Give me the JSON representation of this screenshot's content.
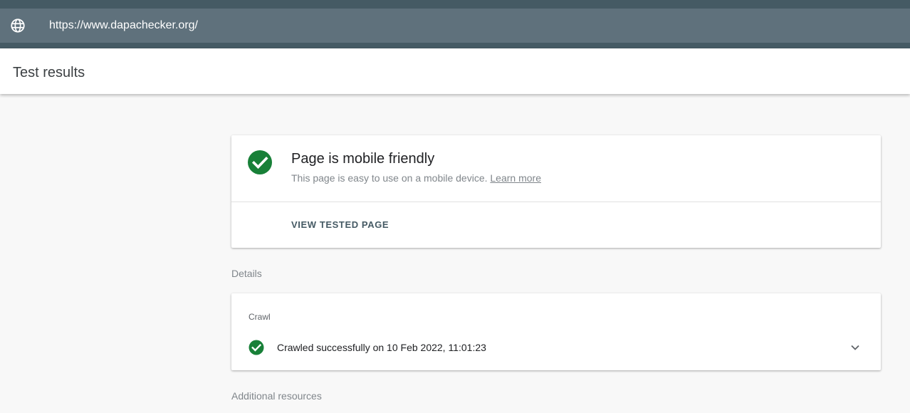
{
  "url_bar": {
    "url": "https://www.dapachecker.org/",
    "icon": "globe-icon"
  },
  "header": {
    "title": "Test results"
  },
  "result": {
    "icon": "check-circle-icon",
    "title": "Page is mobile friendly",
    "subtitle": "This page is easy to use on a mobile device.",
    "learn_more": "Learn more",
    "view_button": "VIEW TESTED PAGE"
  },
  "details": {
    "label": "Details",
    "crawl": {
      "label": "Crawl",
      "icon": "check-circle-icon",
      "status": "Crawled successfully on 10 Feb 2022, 11:01:23",
      "expand_icon": "chevron-down-icon"
    }
  },
  "additional": {
    "label": "Additional resources"
  },
  "colors": {
    "success": "#188038",
    "toolbar": "#5f717c",
    "toolbar_dark": "#455a64",
    "button_text": "#455a64"
  }
}
